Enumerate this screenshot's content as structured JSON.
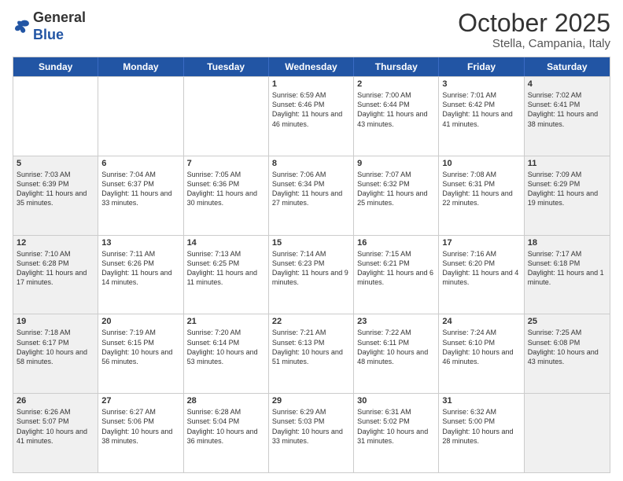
{
  "header": {
    "logo_general": "General",
    "logo_blue": "Blue",
    "month_title": "October 2025",
    "subtitle": "Stella, Campania, Italy"
  },
  "days_of_week": [
    "Sunday",
    "Monday",
    "Tuesday",
    "Wednesday",
    "Thursday",
    "Friday",
    "Saturday"
  ],
  "weeks": [
    [
      {
        "day": "",
        "text": "",
        "shaded": false
      },
      {
        "day": "",
        "text": "",
        "shaded": false
      },
      {
        "day": "",
        "text": "",
        "shaded": false
      },
      {
        "day": "1",
        "text": "Sunrise: 6:59 AM\nSunset: 6:46 PM\nDaylight: 11 hours and 46 minutes.",
        "shaded": false
      },
      {
        "day": "2",
        "text": "Sunrise: 7:00 AM\nSunset: 6:44 PM\nDaylight: 11 hours and 43 minutes.",
        "shaded": false
      },
      {
        "day": "3",
        "text": "Sunrise: 7:01 AM\nSunset: 6:42 PM\nDaylight: 11 hours and 41 minutes.",
        "shaded": false
      },
      {
        "day": "4",
        "text": "Sunrise: 7:02 AM\nSunset: 6:41 PM\nDaylight: 11 hours and 38 minutes.",
        "shaded": true
      }
    ],
    [
      {
        "day": "5",
        "text": "Sunrise: 7:03 AM\nSunset: 6:39 PM\nDaylight: 11 hours and 35 minutes.",
        "shaded": true
      },
      {
        "day": "6",
        "text": "Sunrise: 7:04 AM\nSunset: 6:37 PM\nDaylight: 11 hours and 33 minutes.",
        "shaded": false
      },
      {
        "day": "7",
        "text": "Sunrise: 7:05 AM\nSunset: 6:36 PM\nDaylight: 11 hours and 30 minutes.",
        "shaded": false
      },
      {
        "day": "8",
        "text": "Sunrise: 7:06 AM\nSunset: 6:34 PM\nDaylight: 11 hours and 27 minutes.",
        "shaded": false
      },
      {
        "day": "9",
        "text": "Sunrise: 7:07 AM\nSunset: 6:32 PM\nDaylight: 11 hours and 25 minutes.",
        "shaded": false
      },
      {
        "day": "10",
        "text": "Sunrise: 7:08 AM\nSunset: 6:31 PM\nDaylight: 11 hours and 22 minutes.",
        "shaded": false
      },
      {
        "day": "11",
        "text": "Sunrise: 7:09 AM\nSunset: 6:29 PM\nDaylight: 11 hours and 19 minutes.",
        "shaded": true
      }
    ],
    [
      {
        "day": "12",
        "text": "Sunrise: 7:10 AM\nSunset: 6:28 PM\nDaylight: 11 hours and 17 minutes.",
        "shaded": true
      },
      {
        "day": "13",
        "text": "Sunrise: 7:11 AM\nSunset: 6:26 PM\nDaylight: 11 hours and 14 minutes.",
        "shaded": false
      },
      {
        "day": "14",
        "text": "Sunrise: 7:13 AM\nSunset: 6:25 PM\nDaylight: 11 hours and 11 minutes.",
        "shaded": false
      },
      {
        "day": "15",
        "text": "Sunrise: 7:14 AM\nSunset: 6:23 PM\nDaylight: 11 hours and 9 minutes.",
        "shaded": false
      },
      {
        "day": "16",
        "text": "Sunrise: 7:15 AM\nSunset: 6:21 PM\nDaylight: 11 hours and 6 minutes.",
        "shaded": false
      },
      {
        "day": "17",
        "text": "Sunrise: 7:16 AM\nSunset: 6:20 PM\nDaylight: 11 hours and 4 minutes.",
        "shaded": false
      },
      {
        "day": "18",
        "text": "Sunrise: 7:17 AM\nSunset: 6:18 PM\nDaylight: 11 hours and 1 minute.",
        "shaded": true
      }
    ],
    [
      {
        "day": "19",
        "text": "Sunrise: 7:18 AM\nSunset: 6:17 PM\nDaylight: 10 hours and 58 minutes.",
        "shaded": true
      },
      {
        "day": "20",
        "text": "Sunrise: 7:19 AM\nSunset: 6:15 PM\nDaylight: 10 hours and 56 minutes.",
        "shaded": false
      },
      {
        "day": "21",
        "text": "Sunrise: 7:20 AM\nSunset: 6:14 PM\nDaylight: 10 hours and 53 minutes.",
        "shaded": false
      },
      {
        "day": "22",
        "text": "Sunrise: 7:21 AM\nSunset: 6:13 PM\nDaylight: 10 hours and 51 minutes.",
        "shaded": false
      },
      {
        "day": "23",
        "text": "Sunrise: 7:22 AM\nSunset: 6:11 PM\nDaylight: 10 hours and 48 minutes.",
        "shaded": false
      },
      {
        "day": "24",
        "text": "Sunrise: 7:24 AM\nSunset: 6:10 PM\nDaylight: 10 hours and 46 minutes.",
        "shaded": false
      },
      {
        "day": "25",
        "text": "Sunrise: 7:25 AM\nSunset: 6:08 PM\nDaylight: 10 hours and 43 minutes.",
        "shaded": true
      }
    ],
    [
      {
        "day": "26",
        "text": "Sunrise: 6:26 AM\nSunset: 5:07 PM\nDaylight: 10 hours and 41 minutes.",
        "shaded": true
      },
      {
        "day": "27",
        "text": "Sunrise: 6:27 AM\nSunset: 5:06 PM\nDaylight: 10 hours and 38 minutes.",
        "shaded": false
      },
      {
        "day": "28",
        "text": "Sunrise: 6:28 AM\nSunset: 5:04 PM\nDaylight: 10 hours and 36 minutes.",
        "shaded": false
      },
      {
        "day": "29",
        "text": "Sunrise: 6:29 AM\nSunset: 5:03 PM\nDaylight: 10 hours and 33 minutes.",
        "shaded": false
      },
      {
        "day": "30",
        "text": "Sunrise: 6:31 AM\nSunset: 5:02 PM\nDaylight: 10 hours and 31 minutes.",
        "shaded": false
      },
      {
        "day": "31",
        "text": "Sunrise: 6:32 AM\nSunset: 5:00 PM\nDaylight: 10 hours and 28 minutes.",
        "shaded": false
      },
      {
        "day": "",
        "text": "",
        "shaded": true
      }
    ]
  ]
}
